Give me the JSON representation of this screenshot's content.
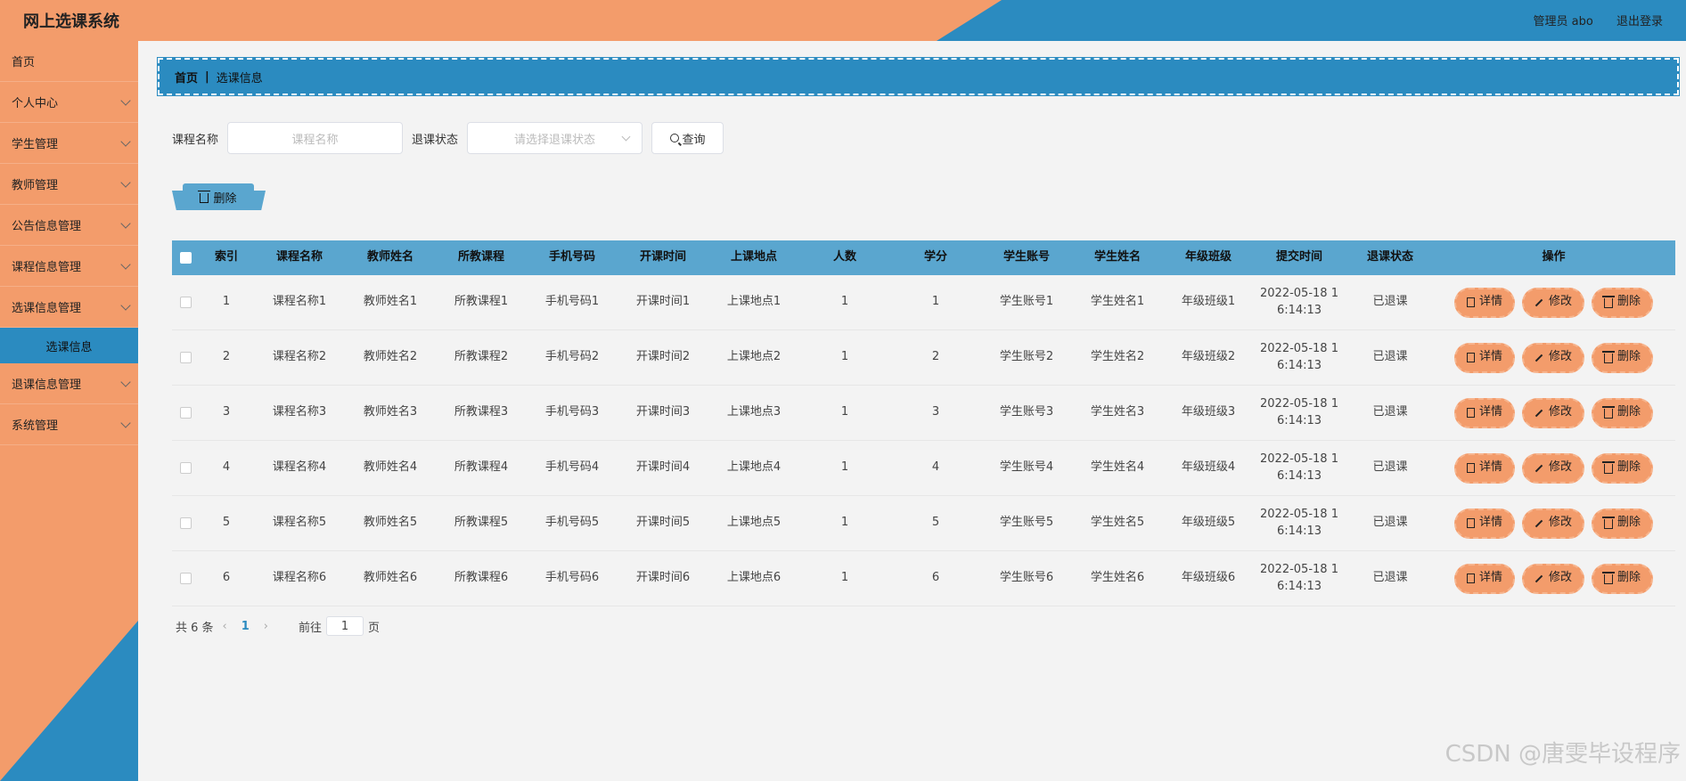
{
  "app": {
    "title": "网上选课系统"
  },
  "header": {
    "user": "管理员 abo",
    "logout": "退出登录"
  },
  "sidebar": {
    "items": [
      {
        "label": "首页",
        "has_arrow": false
      },
      {
        "label": "个人中心",
        "has_arrow": true
      },
      {
        "label": "学生管理",
        "has_arrow": true
      },
      {
        "label": "教师管理",
        "has_arrow": true
      },
      {
        "label": "公告信息管理",
        "has_arrow": true
      },
      {
        "label": "课程信息管理",
        "has_arrow": true
      },
      {
        "label": "选课信息管理",
        "has_arrow": true
      },
      {
        "label": "退课信息管理",
        "has_arrow": true
      },
      {
        "label": "系统管理",
        "has_arrow": true
      }
    ],
    "submenu": {
      "label": "选课信息"
    }
  },
  "breadcrumb": {
    "home": "首页",
    "sep": "|",
    "current": "选课信息"
  },
  "search": {
    "course_label": "课程名称",
    "course_placeholder": "课程名称",
    "status_label": "退课状态",
    "status_placeholder": "请选择退课状态",
    "query_label": "查询"
  },
  "bulk": {
    "delete_label": "删除"
  },
  "table": {
    "headers": [
      "索引",
      "课程名称",
      "教师姓名",
      "所教课程",
      "手机号码",
      "开课时间",
      "上课地点",
      "人数",
      "学分",
      "学生账号",
      "学生姓名",
      "年级班级",
      "提交时间",
      "退课状态",
      "操作"
    ],
    "rows": [
      [
        "1",
        "课程名称1",
        "教师姓名1",
        "所教课程1",
        "手机号码1",
        "开课时间1",
        "上课地点1",
        "1",
        "1",
        "学生账号1",
        "学生姓名1",
        "年级班级1",
        "2022-05-18 1\n6:14:13",
        "已退课"
      ],
      [
        "2",
        "课程名称2",
        "教师姓名2",
        "所教课程2",
        "手机号码2",
        "开课时间2",
        "上课地点2",
        "1",
        "2",
        "学生账号2",
        "学生姓名2",
        "年级班级2",
        "2022-05-18 1\n6:14:13",
        "已退课"
      ],
      [
        "3",
        "课程名称3",
        "教师姓名3",
        "所教课程3",
        "手机号码3",
        "开课时间3",
        "上课地点3",
        "1",
        "3",
        "学生账号3",
        "学生姓名3",
        "年级班级3",
        "2022-05-18 1\n6:14:13",
        "已退课"
      ],
      [
        "4",
        "课程名称4",
        "教师姓名4",
        "所教课程4",
        "手机号码4",
        "开课时间4",
        "上课地点4",
        "1",
        "4",
        "学生账号4",
        "学生姓名4",
        "年级班级4",
        "2022-05-18 1\n6:14:13",
        "已退课"
      ],
      [
        "5",
        "课程名称5",
        "教师姓名5",
        "所教课程5",
        "手机号码5",
        "开课时间5",
        "上课地点5",
        "1",
        "5",
        "学生账号5",
        "学生姓名5",
        "年级班级5",
        "2022-05-18 1\n6:14:13",
        "已退课"
      ],
      [
        "6",
        "课程名称6",
        "教师姓名6",
        "所教课程6",
        "手机号码6",
        "开课时间6",
        "上课地点6",
        "1",
        "6",
        "学生账号6",
        "学生姓名6",
        "年级班级6",
        "2022-05-18 1\n6:14:13",
        "已退课"
      ]
    ],
    "actions": {
      "detail": "详情",
      "edit": "修改",
      "delete": "删除"
    }
  },
  "pagination": {
    "total": "共 6 条",
    "current_page": "1",
    "goto_prefix": "前往",
    "goto_value": "1",
    "goto_suffix": "页"
  },
  "watermark": "CSDN @唐雯毕设程序",
  "colors": {
    "orange": "#f39c6b",
    "blue": "#2b8bc0",
    "table_header": "#5aa6cf"
  }
}
